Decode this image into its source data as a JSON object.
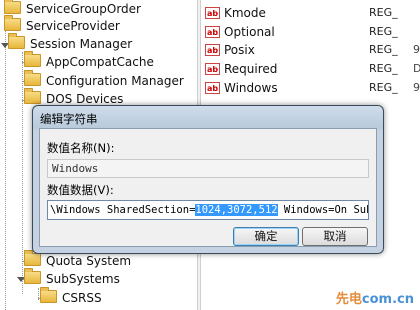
{
  "tree": {
    "items": [
      {
        "label": "ServiceGroupOrder"
      },
      {
        "label": "ServiceProvider"
      },
      {
        "label": "Session Manager"
      },
      {
        "label": "AppCompatCache"
      },
      {
        "label": "Configuration Manager"
      },
      {
        "label": "DOS Devices"
      },
      {
        "label": "Quota System"
      },
      {
        "label": "SubSystems"
      },
      {
        "label": "CSRSS"
      }
    ]
  },
  "values": {
    "rows": [
      {
        "name": "Kmode",
        "type": "REG_",
        "extra": ""
      },
      {
        "name": "Optional",
        "type": "REG_",
        "extra": ""
      },
      {
        "name": "Posix",
        "type": "REG_",
        "extra": "9"
      },
      {
        "name": "Required",
        "type": "REG_",
        "extra": "D"
      },
      {
        "name": "Windows",
        "type": "REG_",
        "extra": "9"
      }
    ],
    "icon": "string-value-icon"
  },
  "dialog": {
    "title": "编辑字符串",
    "name_label": "数值名称(N):",
    "name_value": "Windows",
    "data_label": "数值数据(V):",
    "data_before": "\\Windows SharedSection=",
    "data_selected": "1024,3072,512",
    "data_after": " Windows=On SubSystemTy",
    "ok_label": "确定",
    "cancel_label": "取消"
  },
  "watermark": {
    "text_a": "先电",
    "text_b": "com.cn"
  },
  "colors": {
    "selection": "#3399ff",
    "dialog_frame": "#c4d2e1",
    "folder": "#e8b63c"
  }
}
